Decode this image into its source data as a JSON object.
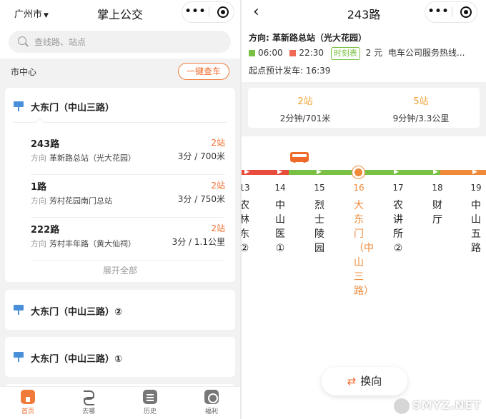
{
  "left": {
    "city": "广州市",
    "title": "掌上公交",
    "search_placeholder": "查线路、站点",
    "area": "市中心",
    "quick_query": "一键查车",
    "stops": [
      {
        "name": "大东门（中山三路）",
        "routes": [
          {
            "name": "243路",
            "dir_label": "方向",
            "destination": "革新路总站（光大花园）",
            "stops_away": "2站",
            "eta": "3分 / 700米"
          },
          {
            "name": "1路",
            "dir_label": "方向",
            "destination": "芳村花园南门总站",
            "stops_away": "2站",
            "eta": "3分 / 750米"
          },
          {
            "name": "222路",
            "dir_label": "方向",
            "destination": "芳村丰年路（黄大仙祠）",
            "stops_away": "2站",
            "eta": "3分 / 1.1公里"
          }
        ],
        "expand": "展开全部"
      },
      {
        "name": "大东门（中山三路）②"
      },
      {
        "name": "大东门（中山三路）①"
      }
    ],
    "tabs": [
      {
        "label": "首页",
        "icon": "home-icon",
        "active": true
      },
      {
        "label": "去哪",
        "icon": "route-icon"
      },
      {
        "label": "历史",
        "icon": "history-icon"
      },
      {
        "label": "福利",
        "icon": "gift-icon"
      }
    ]
  },
  "right": {
    "title": "243路",
    "direction": "方向: 革新路总站（光大花园）",
    "first_bus": "06:00",
    "last_bus": "22:30",
    "timetable": "时刻表",
    "fare": "2 元",
    "hotline": "电车公司服务热线...",
    "departure": "起点预计发车: 16:39",
    "buses": [
      {
        "stops": "2站",
        "detail": "2分钟/701米"
      },
      {
        "stops": "5站",
        "detail": "9分钟/3.3公里"
      }
    ],
    "stations": [
      {
        "num": "13",
        "name": "农林东②"
      },
      {
        "num": "14",
        "name": "中山医①"
      },
      {
        "num": "15",
        "name": "烈士陵园"
      },
      {
        "num": "16",
        "name": "大东门（中山三路）",
        "current": true
      },
      {
        "num": "17",
        "name": "农讲所②"
      },
      {
        "num": "18",
        "name": "财厅"
      },
      {
        "num": "19",
        "name": "中山五路"
      }
    ],
    "switch": "换向",
    "watermark": "SMYZ.NET"
  },
  "colors": {
    "accent": "#ef6a2a",
    "green": "#7ac143",
    "red": "#e84c3d",
    "blue": "#4a90d9"
  }
}
